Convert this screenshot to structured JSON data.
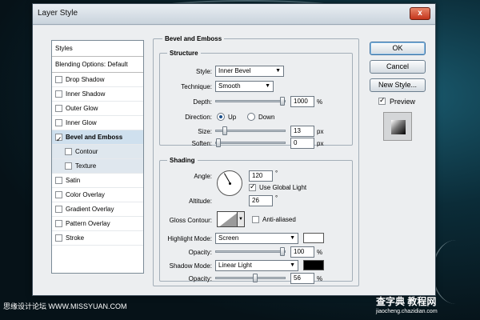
{
  "window": {
    "title": "Layer Style",
    "close_glyph": "x"
  },
  "left_panel": {
    "styles_header": "Styles",
    "blending_header": "Blending Options: Default",
    "items": [
      {
        "label": "Drop Shadow",
        "checked": false
      },
      {
        "label": "Inner Shadow",
        "checked": false
      },
      {
        "label": "Outer Glow",
        "checked": false
      },
      {
        "label": "Inner Glow",
        "checked": false
      },
      {
        "label": "Bevel and Emboss",
        "checked": true
      },
      {
        "label": "Contour",
        "checked": false
      },
      {
        "label": "Texture",
        "checked": false
      },
      {
        "label": "Satin",
        "checked": false
      },
      {
        "label": "Color Overlay",
        "checked": false
      },
      {
        "label": "Gradient Overlay",
        "checked": false
      },
      {
        "label": "Pattern Overlay",
        "checked": false
      },
      {
        "label": "Stroke",
        "checked": false
      }
    ]
  },
  "bevel": {
    "title": "Bevel and Emboss",
    "structure": {
      "title": "Structure",
      "style_label": "Style:",
      "style_value": "Inner Bevel",
      "technique_label": "Technique:",
      "technique_value": "Smooth",
      "depth_label": "Depth:",
      "depth_value": "1000",
      "depth_unit": "%",
      "direction_label": "Direction:",
      "direction_up": "Up",
      "direction_down": "Down",
      "size_label": "Size:",
      "size_value": "13",
      "size_unit": "px",
      "soften_label": "Soften:",
      "soften_value": "0",
      "soften_unit": "px"
    },
    "shading": {
      "title": "Shading",
      "angle_label": "Angle:",
      "angle_value": "120",
      "angle_unit": "°",
      "global_light_label": "Use Global Light",
      "altitude_label": "Altitude:",
      "altitude_value": "26",
      "altitude_unit": "°",
      "gloss_label": "Gloss Contour:",
      "anti_aliased_label": "Anti-aliased",
      "highlight_mode_label": "Highlight Mode:",
      "highlight_mode_value": "Screen",
      "highlight_opacity_label": "Opacity:",
      "highlight_opacity_value": "100",
      "highlight_opacity_unit": "%",
      "shadow_mode_label": "Shadow Mode:",
      "shadow_mode_value": "Linear Light",
      "shadow_opacity_label": "Opacity:",
      "shadow_opacity_value": "56",
      "shadow_opacity_unit": "%",
      "highlight_color": "#ffffff",
      "shadow_color": "#000000"
    }
  },
  "buttons": {
    "ok": "OK",
    "cancel": "Cancel",
    "new_style": "New Style...",
    "preview": "Preview"
  },
  "watermarks": {
    "left": "思缘设计论坛 WWW.MISSYUAN.COM",
    "right": "查字典 教程网",
    "right_url": "jiaocheng.chazidian.com"
  }
}
